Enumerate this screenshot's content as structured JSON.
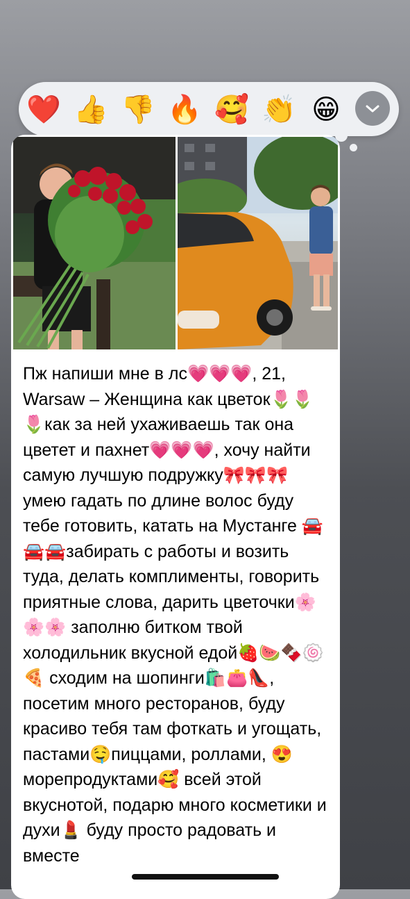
{
  "reactions": [
    {
      "name": "heart",
      "glyph": "❤️"
    },
    {
      "name": "thumbs-up",
      "glyph": "👍"
    },
    {
      "name": "thumbs-down",
      "glyph": "👎"
    },
    {
      "name": "fire",
      "glyph": "🔥"
    },
    {
      "name": "smiling-face-with-hearts",
      "glyph": "🥰"
    },
    {
      "name": "clapping-hands",
      "glyph": "👏"
    },
    {
      "name": "grinning-face",
      "glyph": "😁"
    }
  ],
  "more_reactions_icon": "chevron-down-icon",
  "message": {
    "photos": [
      {
        "name": "photo-man-with-roses",
        "description_icon": "roses"
      },
      {
        "name": "photo-man-with-orange-mustang",
        "description_icon": "car"
      }
    ],
    "text": "Пж напиши мне в лс💗💗💗, 21, Warsaw – Женщина как цветок🌷🌷🌷как за ней ухаживаешь так она цветет и пахнет💗💗💗, хочу найти самую лучшую подружку🎀🎀🎀 умею гадать по длине волос буду тебе готовить, катать на Мустанге 🚘🚘🚘забирать с работы и возить туда, делать комплименты, говорить приятные слова, дарить цветочки🌸🌸🌸 заполню  битком твой холодильник вкусной едой🍓🍉🍫🍥🍕 сходим на шопинги🛍️👛👠, посетим много ресторанов, буду красиво тебя там фоткать и угощать, пастами🤤пиццами, роллами, 😍морепродуктами🥰 всей этой вкуснотой, подарю много косметики и духи💄 буду просто радовать и вместе"
  },
  "colors": {
    "bubble": "#ffffff",
    "reaction_bar": "#eef0f3",
    "text": "#000000"
  }
}
